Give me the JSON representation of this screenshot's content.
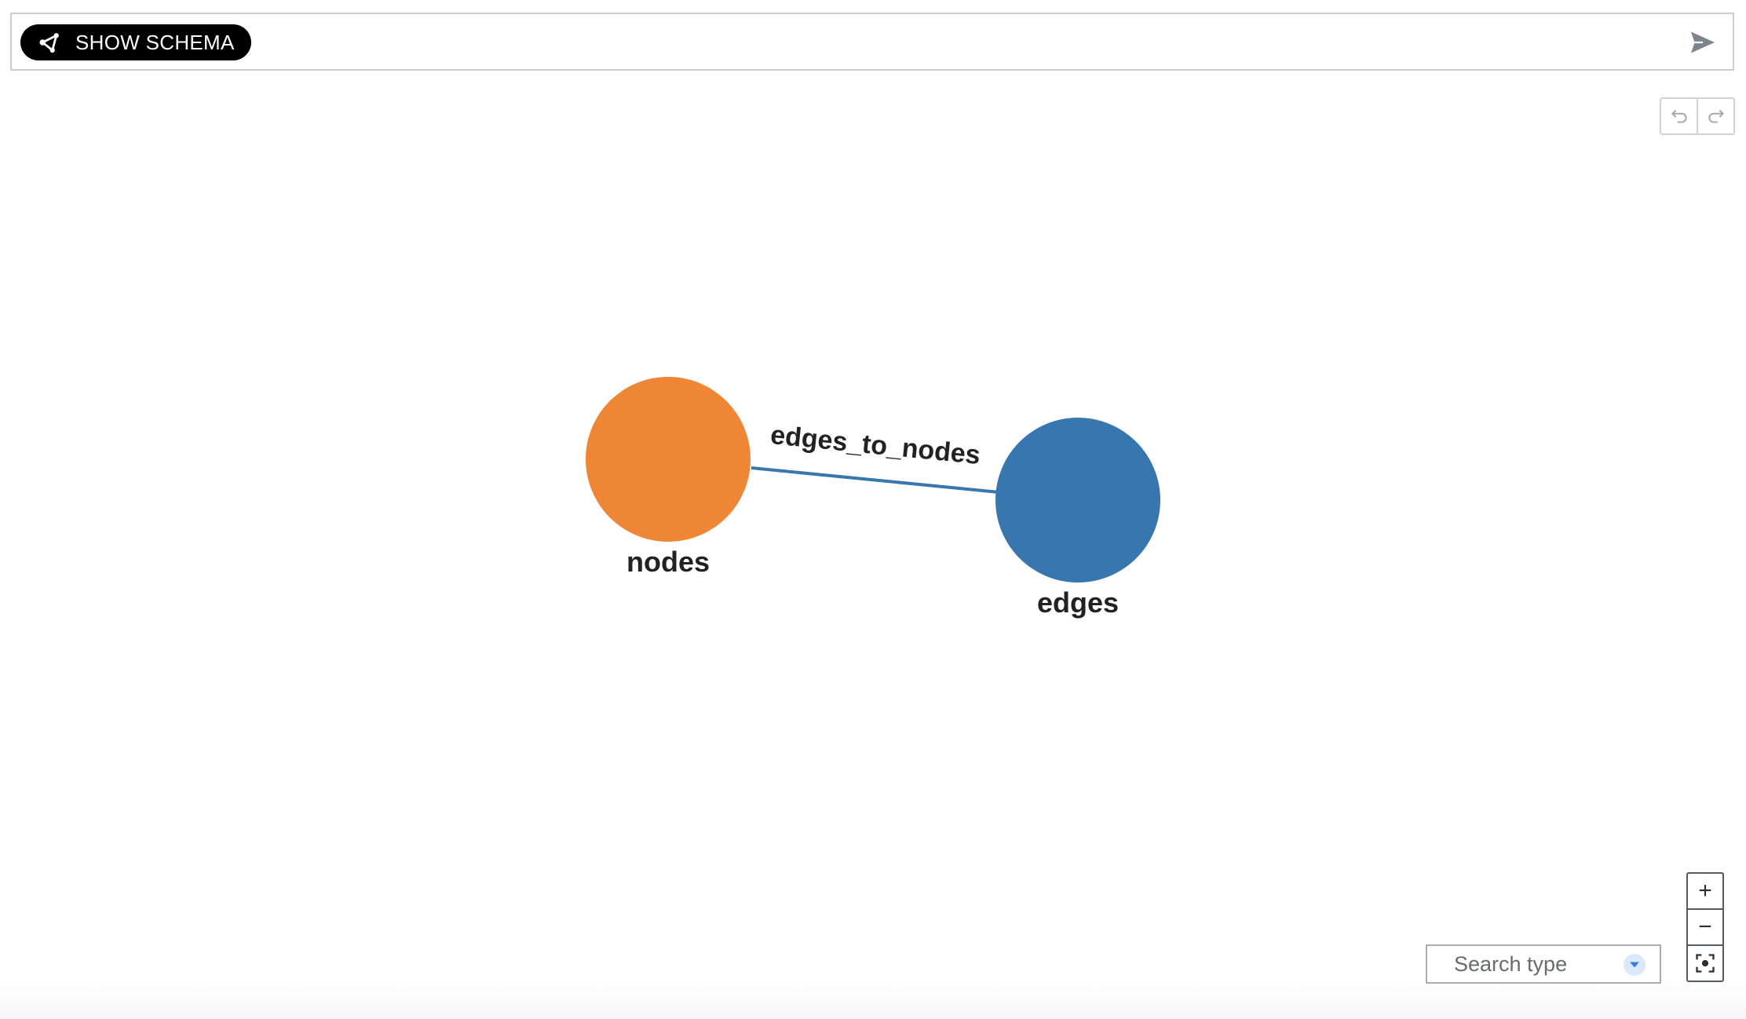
{
  "toolbar": {
    "schema_button_label": "SHOW SCHEMA",
    "schema_icon": "graph-share-icon",
    "send_icon": "send-icon",
    "undo_icon": "undo-icon",
    "redo_icon": "redo-icon"
  },
  "graph": {
    "nodes": [
      {
        "id": "nodes",
        "label": "nodes",
        "color": "#ef8636"
      },
      {
        "id": "edges",
        "label": "edges",
        "color": "#3776ae"
      }
    ],
    "edges": [
      {
        "source": "nodes",
        "target": "edges",
        "label": "edges_to_nodes",
        "color": "#3776ae"
      }
    ]
  },
  "controls": {
    "search_placeholder": "Search type",
    "zoom_in_label": "+",
    "zoom_out_label": "−",
    "fit_icon": "fit-to-screen-icon"
  }
}
